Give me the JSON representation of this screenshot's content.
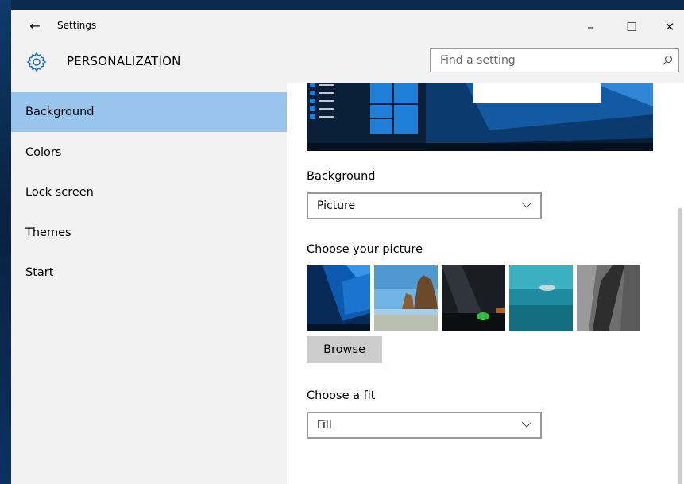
{
  "window": {
    "title": "Settings",
    "controls": {
      "minimize": "–",
      "maximize": "☐",
      "close": "✕"
    }
  },
  "header": {
    "section_title": "PERSONALIZATION",
    "search_placeholder": "Find a setting"
  },
  "sidebar": {
    "items": [
      {
        "label": "Background",
        "active": true
      },
      {
        "label": "Colors"
      },
      {
        "label": "Lock screen"
      },
      {
        "label": "Themes"
      },
      {
        "label": "Start"
      }
    ]
  },
  "main": {
    "background_label": "Background",
    "background_value": "Picture",
    "choose_picture_label": "Choose your picture",
    "browse_label": "Browse",
    "fit_label": "Choose a fit",
    "fit_value": "Fill"
  },
  "colors": {
    "accent": "#99c4ec",
    "chrome": "#f2f2f2",
    "button": "#cccccc"
  },
  "icons": [
    "back-arrow-icon",
    "gear-icon",
    "search-icon",
    "chevron-down-icon"
  ]
}
